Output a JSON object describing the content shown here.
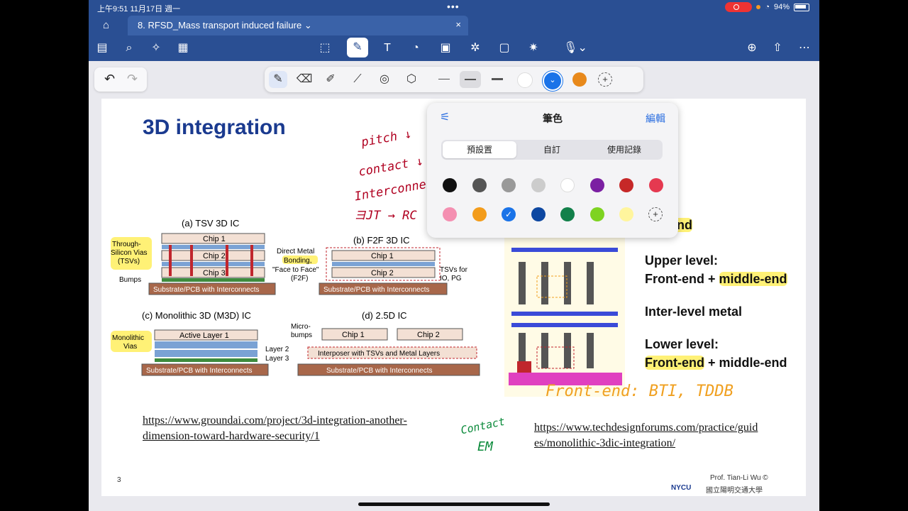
{
  "status_bar": {
    "time": "上午9:51  11月17日 週一",
    "dots": "•••",
    "battery_pct": "94%"
  },
  "tab": {
    "title": "8. RFSD_Mass transport induced failure",
    "chevron": "⌄",
    "close": "×"
  },
  "pen_toolbar": {
    "line_widths": [
      "thin",
      "medium",
      "thick"
    ],
    "colors": [
      "#ffffff",
      "#1a73e8",
      "#e8891b"
    ]
  },
  "slide": {
    "title": "3D integration",
    "page_number": "3",
    "link_left": [
      "https://www.groundai.com/project/3d-integration-another-",
      "dimension-toward-hardware-security/1"
    ],
    "link_right": [
      "https://www.techdesignforums.com/practice/guid",
      "es/monolithic-3dic-integration/"
    ],
    "footer_author": "Prof. Tian-Li Wu ©",
    "footer_logo": "NYCU",
    "footer_school": "國立陽明交通大學",
    "diagram_left": {
      "tsv_title": "(a) TSV 3D IC",
      "f2f_title": "(b) F2F 3D IC",
      "m3d_title": "(c) Monolithic 3D (M3D) IC",
      "d25_title": "(d) 2.5D IC",
      "chip1": "Chip 1",
      "chip2": "Chip 2",
      "chip3": "Chip 3",
      "tsv_label": "Through-Silicon Vias (TSVs)",
      "bumps": "Bumps",
      "substrate": "Substrate/PCB with Interconnects",
      "dmb": "Direct Metal Bonding, \"Face to Face\" (F2F)",
      "tsvs_for": "TSVs for IO, PG",
      "active_layer": "Active Layer 1",
      "mono_vias": "Monolithic Vias",
      "layer2": "Layer 2",
      "layer3": "Layer 3",
      "microbumps": "Micro-bumps",
      "interposer": "Interposer with TSVs and Metal Layers"
    },
    "diagram_right": {
      "end_label": "-end",
      "upper_level": "Upper level:",
      "upper_detail_a": "Front-end",
      "upper_detail_plus": " + ",
      "upper_detail_b": "middle-end",
      "inter_level": "Inter-level metal",
      "lower_level": "Lower level:",
      "lower_detail_a": "Front-end",
      "lower_detail_plus": " + ",
      "lower_detail_b": "middle-end"
    },
    "handwriting": {
      "pitch": "pitch ↓",
      "contact": "contact ↓",
      "interconnect": "Interconnect",
      "rc": "ヨJT → RC",
      "frontend_note": "Front-end: BTI, TDDB",
      "contact_em_1": "Contact",
      "contact_em_2": "EM"
    }
  },
  "popover": {
    "title": "筆色",
    "edit": "編輯",
    "tabs": [
      "預設置",
      "自訂",
      "使用記錄"
    ],
    "row1": [
      "#111111",
      "#555555",
      "#999999",
      "#cccccc",
      "#ffffff",
      "#7b1fa2",
      "#c62828",
      "#e53950"
    ],
    "row2": [
      "#f48fb1",
      "#f39c1b",
      "#1a73e8",
      "#0d47a1",
      "#12804a",
      "#7ed321",
      "#fff59d"
    ]
  }
}
